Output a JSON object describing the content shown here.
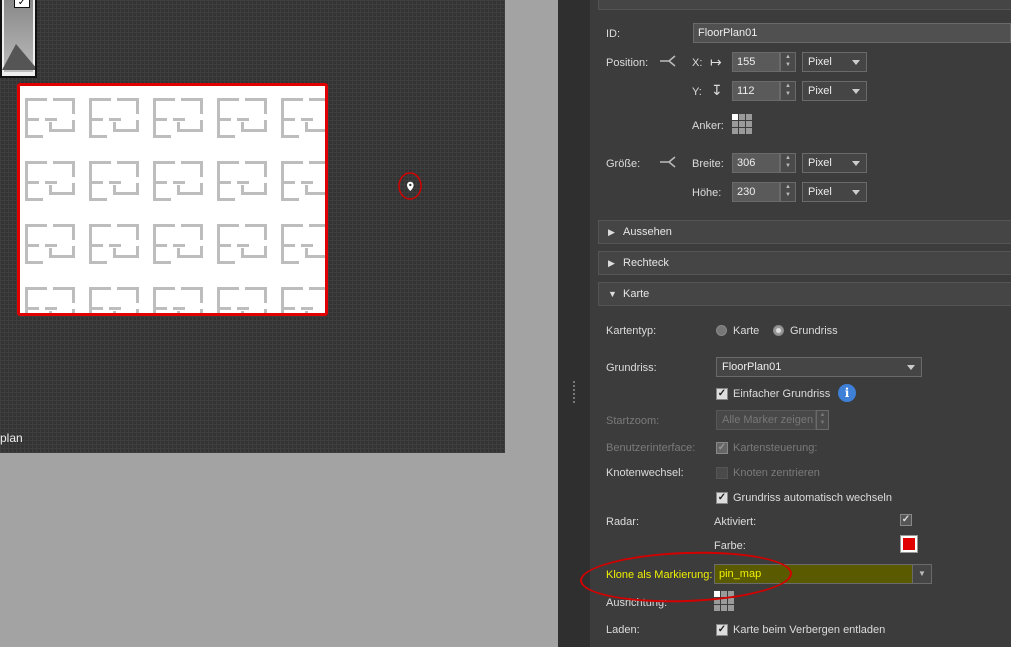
{
  "canvas": {
    "label": "plan",
    "floor_rows": 4,
    "floor_cols": 5
  },
  "panel": {
    "id_label": "ID:",
    "id_value": "FloorPlan01",
    "position_label": "Position:",
    "x_label": "X:",
    "x_value": "155",
    "y_label": "Y:",
    "y_value": "112",
    "unit": "Pixel",
    "anchor_label": "Anker:",
    "size_label": "Größe:",
    "width_label": "Breite:",
    "width_value": "306",
    "height_label": "Höhe:",
    "height_value": "230",
    "sections": [
      "Aussehen",
      "Rechteck",
      "Karte"
    ],
    "map_type_label": "Kartentyp:",
    "map_type_options": [
      "Karte",
      "Grundriss"
    ],
    "floorplan_label": "Grundriss:",
    "floorplan_value": "FloorPlan01",
    "simple_floorplan": "Einfacher Grundriss",
    "startzoom_label": "Startzoom:",
    "startzoom_value": "Alle Marker zeigen",
    "ui_label": "Benutzerinterface:",
    "map_controls": "Kartensteuerung:",
    "node_switch_label": "Knotenwechsel:",
    "center_nodes": "Knoten zentrieren",
    "auto_switch": "Grundriss automatisch wechseln",
    "radar_label": "Radar:",
    "activated_label": "Aktiviert:",
    "color_label": "Farbe:",
    "clone_label": "Klone als Markierung:",
    "clone_value": "pin_map",
    "alignment_label": "Ausrichtung:",
    "load_label": "Laden:",
    "unload_label": "Karte beim Verbergen entladen"
  },
  "colors": {
    "accent_red": "#e00000",
    "highlight": "#5a5a00",
    "clone_text": "#f0f000"
  }
}
